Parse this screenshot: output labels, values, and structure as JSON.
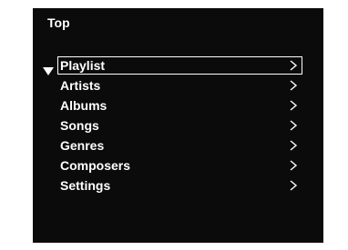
{
  "header": {
    "title": "Top"
  },
  "menu": {
    "selected_index": 0,
    "items": [
      {
        "label": "Playlist",
        "icon": "chevron-right-icon"
      },
      {
        "label": "Artists",
        "icon": "chevron-right-icon"
      },
      {
        "label": "Albums",
        "icon": "chevron-right-icon"
      },
      {
        "label": "Songs",
        "icon": "chevron-right-icon"
      },
      {
        "label": "Genres",
        "icon": "chevron-right-icon"
      },
      {
        "label": "Composers",
        "icon": "chevron-right-icon"
      },
      {
        "label": "Settings",
        "icon": "chevron-right-icon"
      }
    ]
  },
  "colors": {
    "background": "#0b0b0b",
    "text": "#ffffff"
  }
}
